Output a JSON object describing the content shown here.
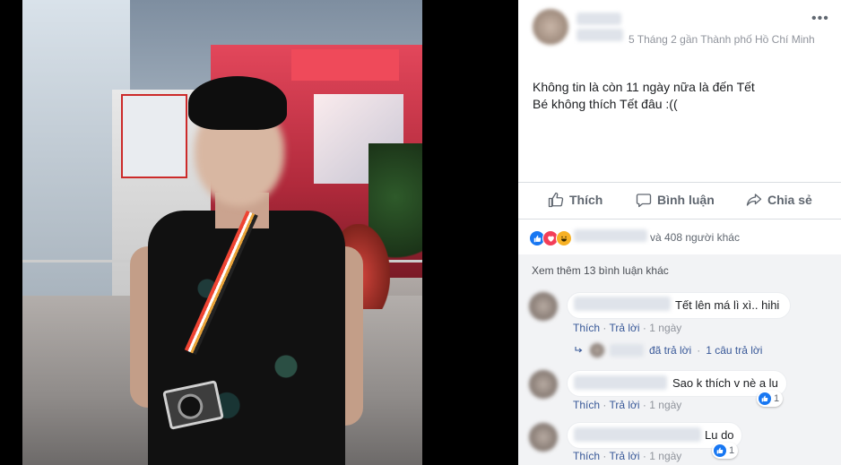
{
  "post": {
    "meta": "5 Tháng 2 gần Thành phố Hồ Chí Minh",
    "more": "•••",
    "text_line1": "Không tin là còn 11 ngày nữa là đến Tết",
    "text_line2": "Bé không thích Tết đâu :(("
  },
  "actions": {
    "like": "Thích",
    "comment": "Bình luận",
    "share": "Chia sẻ"
  },
  "reactions": {
    "count_text": "và 408 người khác",
    "icons": [
      "like-icon",
      "love-icon",
      "haha-icon"
    ]
  },
  "comments": {
    "more_link": "Xem thêm 13 bình luận khác",
    "items": [
      {
        "text": "Tết lên má lì xì.. hihi",
        "like": "Thích",
        "reply": "Trả lời",
        "time": "1 ngày",
        "reply_summary": "đã trả lời",
        "reply_count": "1 câu trả lời"
      },
      {
        "text": "Sao k thích v nè a lu",
        "like": "Thích",
        "reply": "Trả lời",
        "time": "1 ngày",
        "likes": "1"
      },
      {
        "text": "Lu do",
        "like": "Thích",
        "reply": "Trả lời",
        "time": "1 ngày",
        "likes": "1"
      }
    ]
  },
  "colors": {
    "link": "#385898",
    "like_blue": "#1877f2",
    "love_red": "#f33e58",
    "haha_yellow": "#f7b125",
    "text_secondary": "#606770"
  }
}
